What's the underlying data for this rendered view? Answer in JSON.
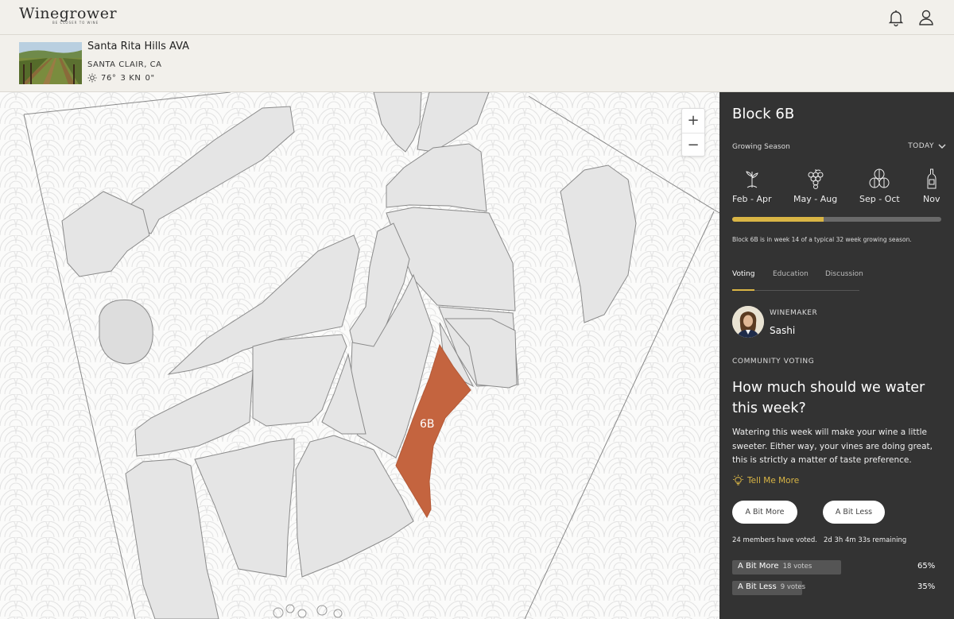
{
  "header": {
    "logo": "Winegrower",
    "logo_tagline": "BE CLOSER TO WINE"
  },
  "location": {
    "title": "Santa Rita Hills AVA",
    "subtitle": "SANTA CLAIR, CA",
    "temperature": "76°",
    "wind": "3 KN",
    "rain": "0\""
  },
  "map": {
    "selected_block_label": "6B",
    "zoom_in": "+",
    "zoom_out": "−",
    "highlight_color": "#c4643f"
  },
  "panel": {
    "title": "Block 6B",
    "season_label": "Growing Season",
    "period_select": "TODAY",
    "stages": [
      {
        "icon": "vine-sprout-icon",
        "label": "Feb - Apr"
      },
      {
        "icon": "grape-cluster-icon",
        "label": "May - Aug"
      },
      {
        "icon": "barrels-icon",
        "label": "Sep - Oct"
      },
      {
        "icon": "wine-bottle-icon",
        "label": "Nov"
      }
    ],
    "progress_fraction": 0.4375,
    "week_text": "Block 6B is in week 14 of a typical 32 week growing season.",
    "tabs": [
      "Voting",
      "Education",
      "Discussion"
    ],
    "winemaker_label": "WINEMAKER",
    "winemaker_name": "Sashi",
    "community_label": "COMMUNITY VOTING",
    "question": "How much should we water this week?",
    "description": "Watering this week will make your wine a little sweeter. Either way, your vines are doing great, this is strictly a matter of taste preference.",
    "tell_more": "Tell Me More",
    "vote_more": "A Bit More",
    "vote_less": "A Bit Less",
    "members_voted": "24 members have voted.",
    "time_remaining": "2d 3h 4m 33s remaining",
    "results": [
      {
        "label": "A Bit More",
        "votes": "18 votes",
        "percent": "65%",
        "fraction": 0.65
      },
      {
        "label": "A Bit Less",
        "votes": "9 votes",
        "percent": "35%",
        "fraction": 0.35
      }
    ],
    "accent_color": "#d9b545"
  }
}
